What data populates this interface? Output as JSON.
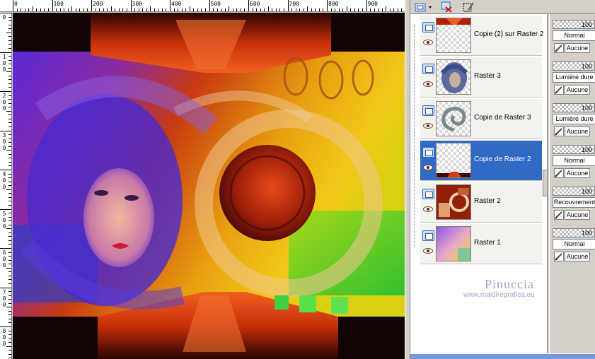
{
  "ruler": {
    "top_labels": [
      "0",
      "100",
      "200",
      "300",
      "400",
      "500",
      "600",
      "700",
      "800",
      "900"
    ],
    "left_labels": [
      [
        "0"
      ],
      [
        "1",
        "0",
        "0"
      ],
      [
        "2",
        "0",
        "0"
      ],
      [
        "3",
        "0",
        "0"
      ],
      [
        "4",
        "0",
        "0"
      ],
      [
        "5",
        "0",
        "0"
      ],
      [
        "6",
        "0",
        "0"
      ],
      [
        "7",
        "0",
        "0"
      ],
      [
        "8",
        "0",
        "0"
      ]
    ]
  },
  "layers": [
    {
      "name": "Copie (2) sur Raster 2",
      "opacity": "100",
      "blend": "Normal",
      "mask": "Aucune",
      "selected": false,
      "thumb": "red-top-strip"
    },
    {
      "name": "Raster 3",
      "opacity": "100",
      "blend": "Lumière dure",
      "mask": "Aucune",
      "selected": false,
      "thumb": "woman-face"
    },
    {
      "name": "Copie de Raster 3",
      "opacity": "100",
      "blend": "Lumière dure",
      "mask": "Aucune",
      "selected": false,
      "thumb": "spiral"
    },
    {
      "name": "Copie de Raster 2",
      "opacity": "100",
      "blend": "Normal",
      "mask": "Aucune",
      "selected": true,
      "thumb": "red-bottom-strip"
    },
    {
      "name": "Raster 2",
      "opacity": "100",
      "blend": "Recouvrement",
      "mask": "Aucune",
      "selected": false,
      "thumb": "red-collage"
    },
    {
      "name": "Raster 1",
      "opacity": "100",
      "blend": "Normal",
      "mask": "Aucune",
      "selected": false,
      "thumb": "rainbow-gradient"
    }
  ],
  "watermark": {
    "name": "Pinuccia",
    "url": "www.maidiregrafica.eu"
  },
  "colors": {
    "selection": "#316ac5",
    "panel": "#d4d0c8",
    "watermark": "#9aa8c8"
  }
}
